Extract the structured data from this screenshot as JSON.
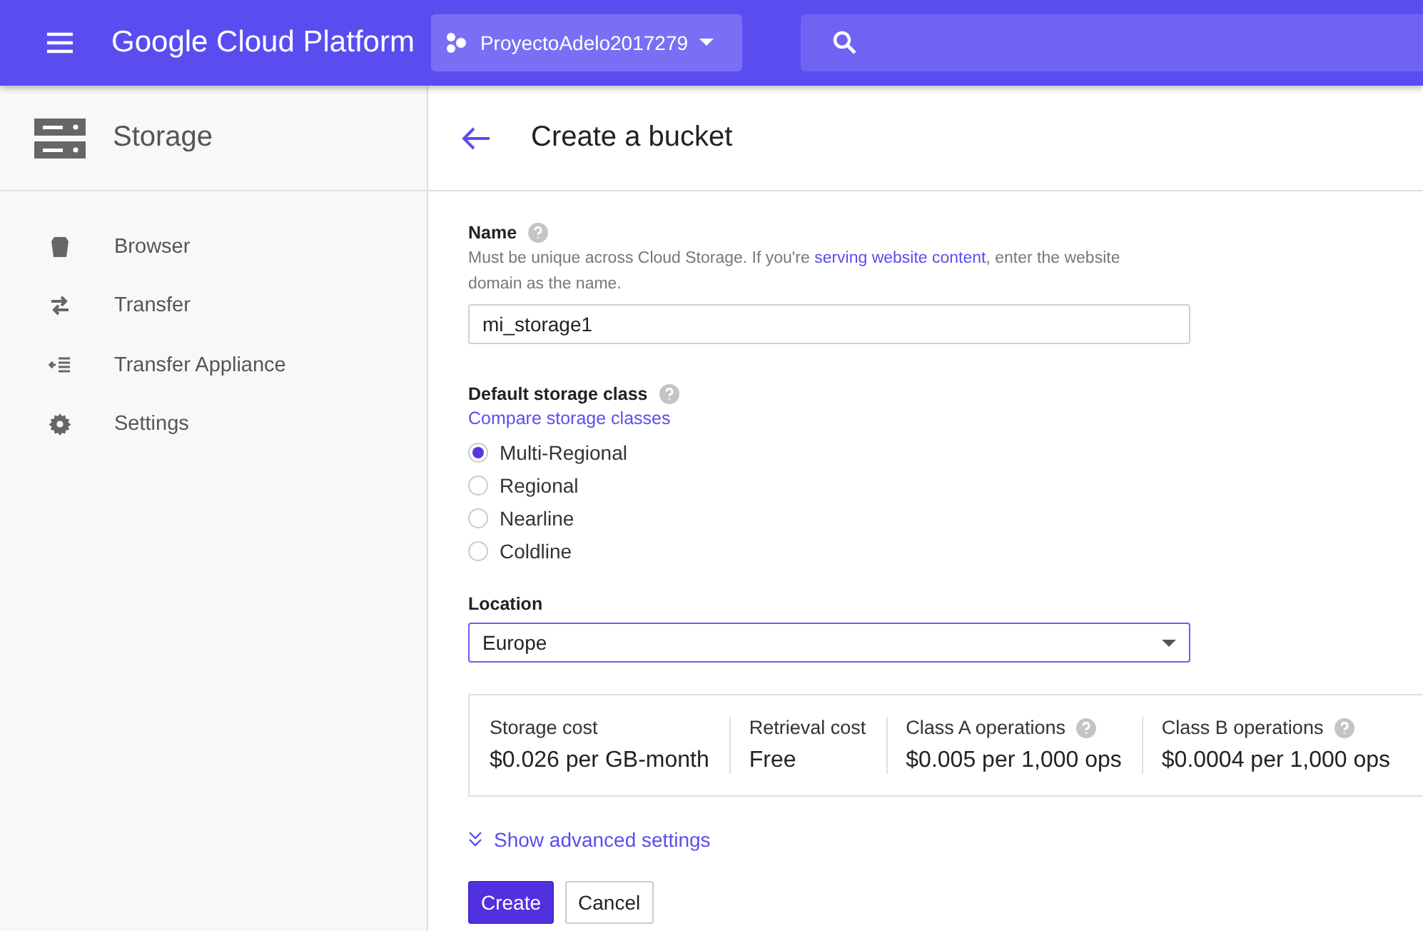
{
  "top_bar": {
    "title": "Google Cloud Platform",
    "project": "ProyectoAdelo2017279"
  },
  "sidebar": {
    "title": "Storage",
    "items": [
      {
        "label": "Browser",
        "kind": "bucket"
      },
      {
        "label": "Transfer",
        "kind": "arrows"
      },
      {
        "label": "Transfer Appliance",
        "kind": "list"
      },
      {
        "label": "Settings",
        "kind": "gear"
      }
    ]
  },
  "page": {
    "title": "Create a bucket"
  },
  "name_field": {
    "label": "Name",
    "help": true,
    "text_before": "Must be unique across Cloud Storage. If you're ",
    "link": "serving website content",
    "text_after": ", enter the website domain as the name.",
    "value": "mi_storage1"
  },
  "storage_class": {
    "label": "Default storage class",
    "help": true,
    "link": "Compare storage classes",
    "options": [
      {
        "label": "Multi-Regional",
        "selected": true
      },
      {
        "label": "Regional",
        "selected": false
      },
      {
        "label": "Nearline",
        "selected": false
      },
      {
        "label": "Coldline",
        "selected": false
      }
    ]
  },
  "location": {
    "label": "Location",
    "value": "Europe",
    "focused": true
  },
  "costs": [
    {
      "label": "Storage cost",
      "value": "$0.026 per GB-month",
      "help": false
    },
    {
      "label": "Retrieval cost",
      "value": "Free",
      "help": false
    },
    {
      "label": "Class A operations",
      "value": "$0.005 per 1,000 ops",
      "help": true
    },
    {
      "label": "Class B operations",
      "value": "$0.0004 per 1,000 ops",
      "help": true
    }
  ],
  "advanced_link": "Show advanced settings",
  "buttons": [
    {
      "label": "Create",
      "kind": "primary"
    },
    {
      "label": "Cancel",
      "kind": "secondary"
    }
  ]
}
